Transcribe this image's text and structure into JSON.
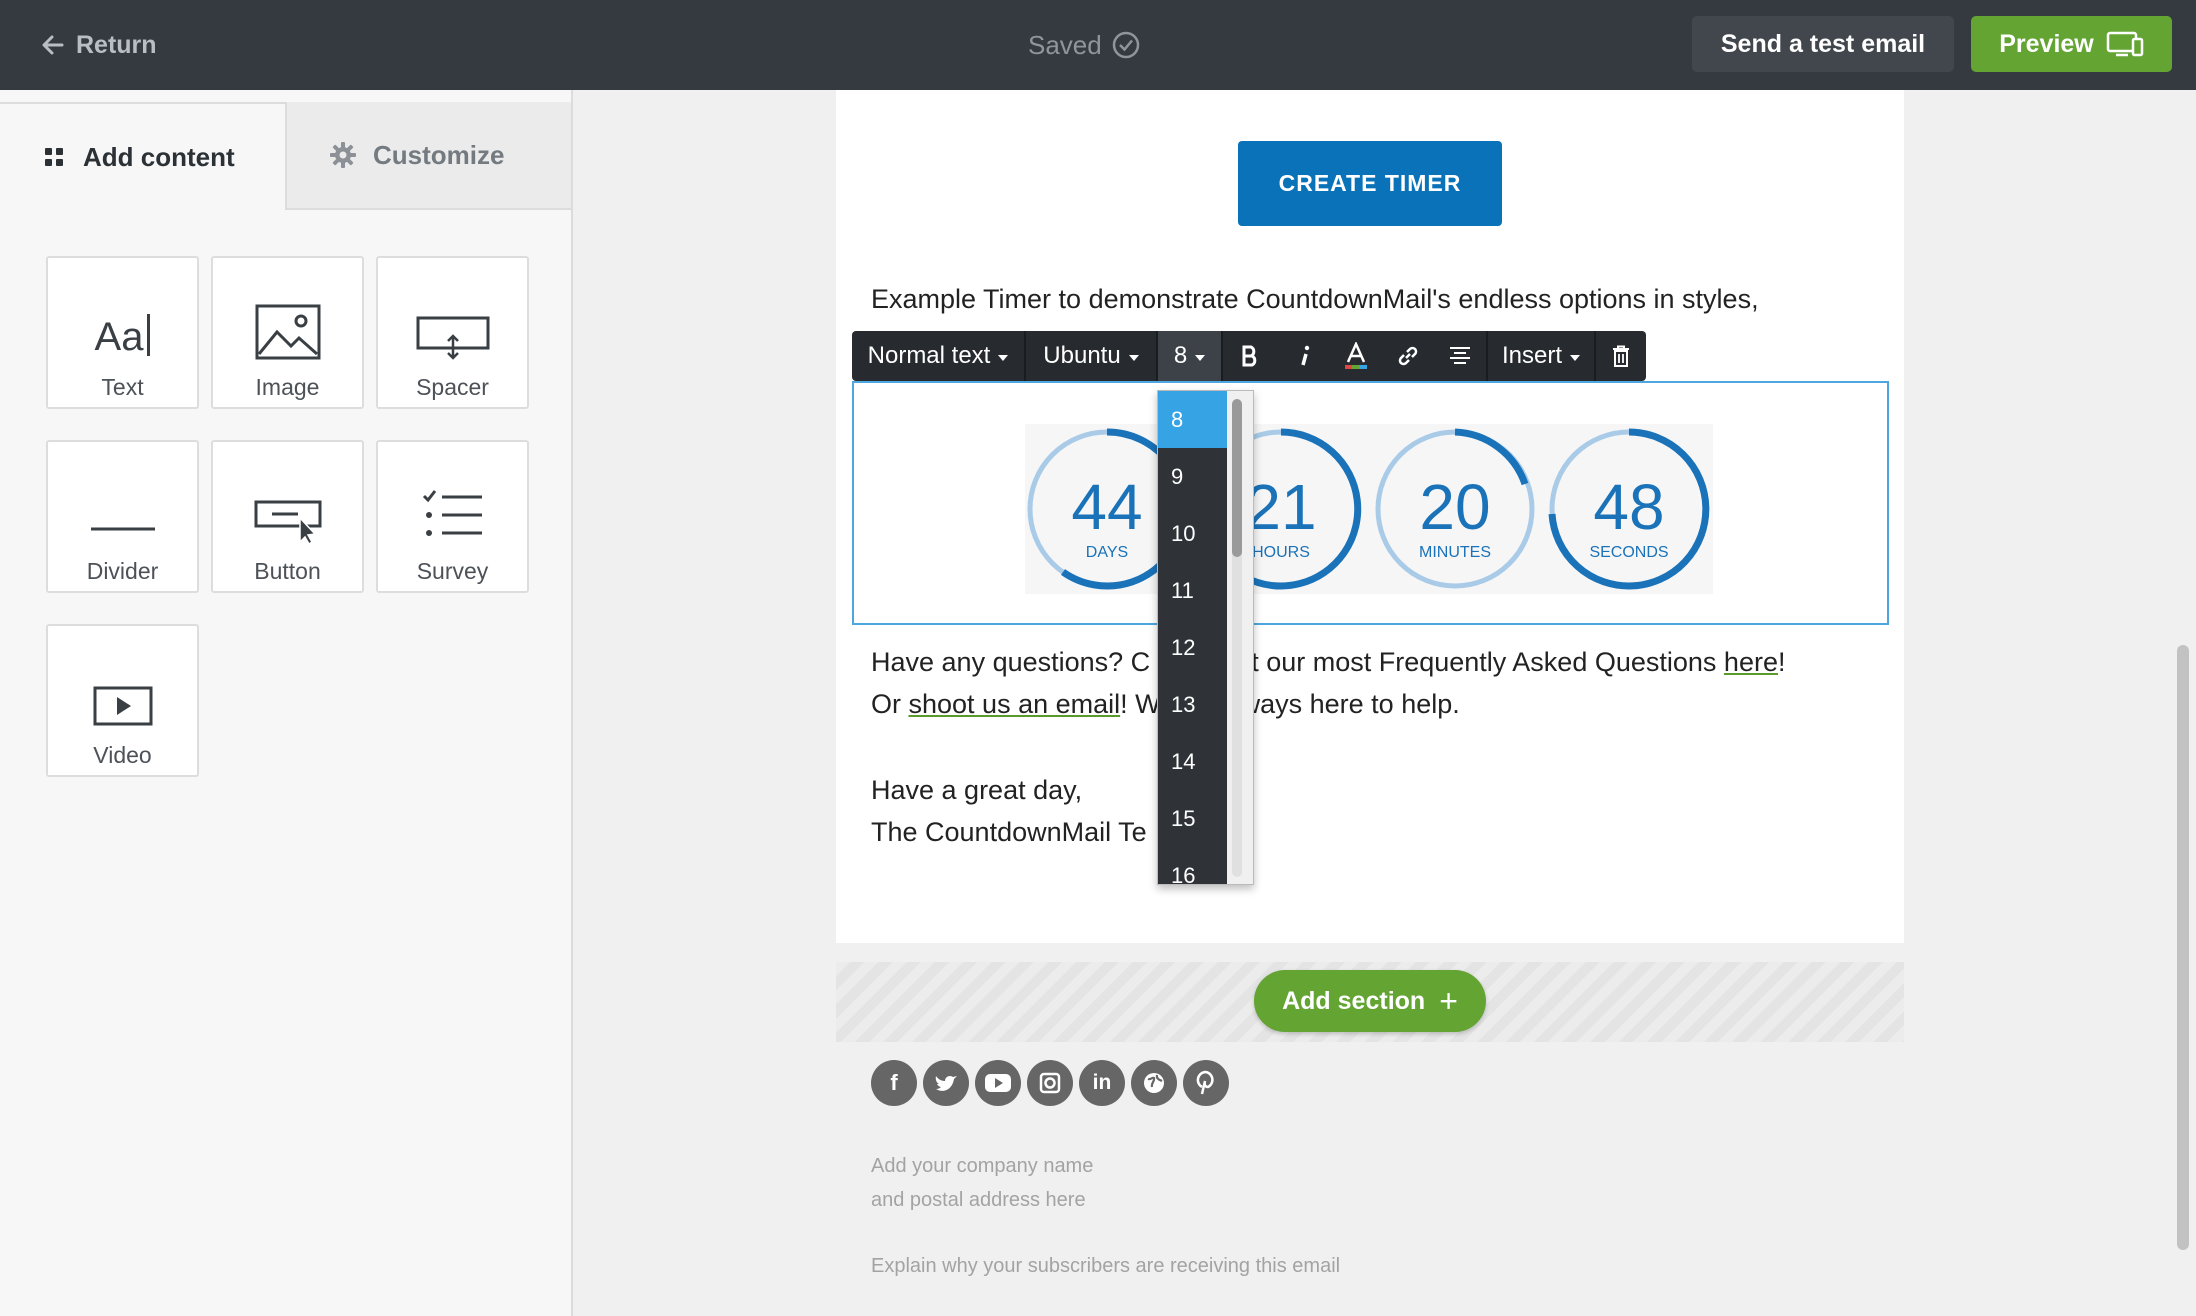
{
  "topbar": {
    "return_label": "Return",
    "saved_label": "Saved",
    "test_email_label": "Send a test email",
    "preview_label": "Preview"
  },
  "left_panel": {
    "tabs": [
      {
        "label": "Add content",
        "icon": "grid-icon",
        "active": true
      },
      {
        "label": "Customize",
        "icon": "gear-icon",
        "active": false
      }
    ],
    "blocks": [
      {
        "label": "Text",
        "icon": "text-icon"
      },
      {
        "label": "Image",
        "icon": "image-icon"
      },
      {
        "label": "Spacer",
        "icon": "spacer-icon"
      },
      {
        "label": "Divider",
        "icon": "divider-icon"
      },
      {
        "label": "Button",
        "icon": "button-icon"
      },
      {
        "label": "Survey",
        "icon": "survey-icon"
      },
      {
        "label": "Video",
        "icon": "video-icon"
      }
    ]
  },
  "email": {
    "create_timer_label": "CREATE TIMER",
    "intro_text": "Example Timer to demonstrate CountdownMail's endless options in styles,",
    "timer": [
      {
        "value": "44",
        "unit": "DAYS"
      },
      {
        "value": "21",
        "unit": "HOURS"
      },
      {
        "value": "20",
        "unit": "MINUTES"
      },
      {
        "value": "48",
        "unit": "SECONDS"
      }
    ],
    "faq_line1_a": "Have any questions? C",
    "faq_line1_b": "ut our most Frequently Asked Questions ",
    "faq_link": "here",
    "faq_line1_c": "!",
    "faq_line2_a": "Or ",
    "email_link": "shoot us an email",
    "faq_line2_b": "! W",
    "faq_line2_c": "ways here to help.",
    "signoff1": "Have a great day,",
    "signoff2": "The CountdownMail Te"
  },
  "toolbar": {
    "style_label": "Normal text",
    "font_label": "Ubuntu",
    "size_label": "8",
    "insert_label": "Insert",
    "colors": {
      "text_color_underline": "#e04848"
    }
  },
  "size_dropdown": {
    "options": [
      "8",
      "9",
      "10",
      "11",
      "12",
      "13",
      "14",
      "15",
      "16"
    ],
    "selected": "8"
  },
  "add_section_label": "Add section",
  "social_icons": [
    "facebook-icon",
    "twitter-icon",
    "youtube-icon",
    "instagram-icon",
    "linkedin-icon",
    "website-icon",
    "pinterest-icon"
  ],
  "footer": {
    "address_line1": "Add your company name",
    "address_line2": "and postal address here",
    "reason": "Explain why your subscribers are receiving this email"
  },
  "colors": {
    "topbar_bg": "#353a40",
    "preview_green": "#63a433",
    "create_timer_blue": "#0a72b8",
    "timer_blue": "#1a72b8",
    "selection_blue": "#36a3e4"
  }
}
